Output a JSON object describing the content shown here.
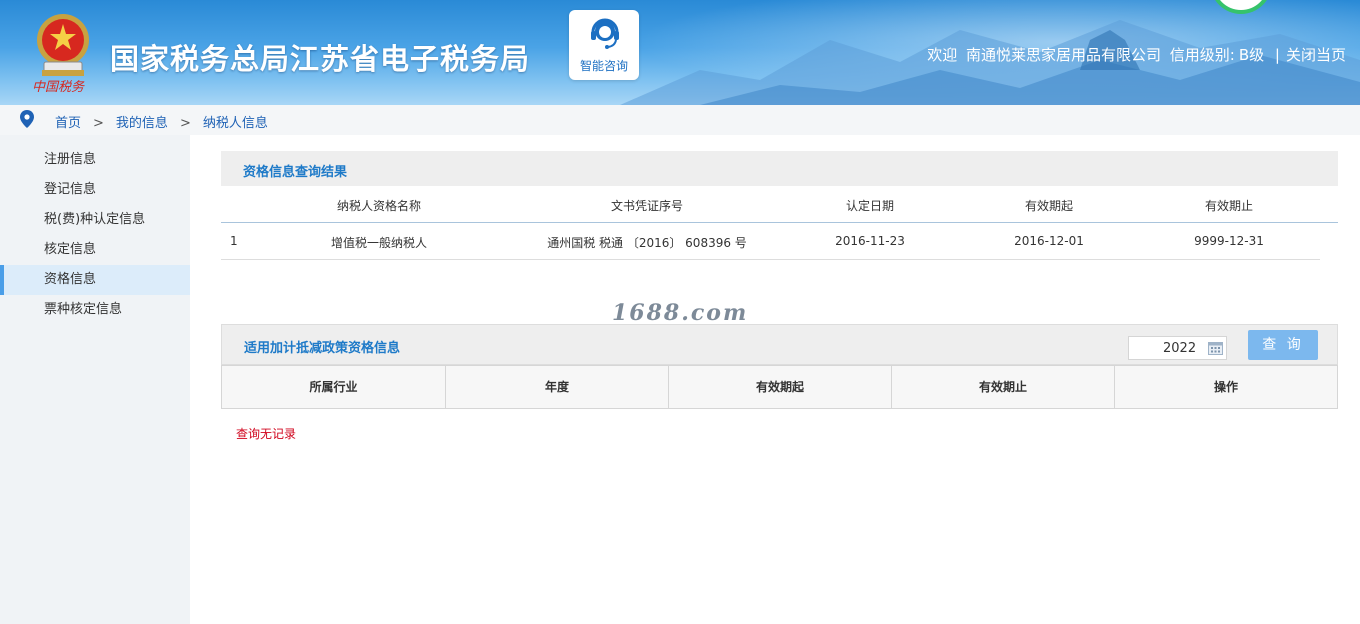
{
  "header": {
    "title": "国家税务总局江苏省电子税务局",
    "emblem_caption": "中国税务",
    "consult_label": "智能咨询",
    "welcome_prefix": "欢迎",
    "company": "南通悦莱思家居用品有限公司",
    "credit_label": "信用级别:",
    "credit_level": "B级",
    "separator": "|",
    "close_link": "关闭当页"
  },
  "breadcrumb": {
    "arrow": ">",
    "items": [
      "首页",
      "我的信息",
      "纳税人信息"
    ]
  },
  "sidebar": {
    "items": [
      {
        "label": "注册信息"
      },
      {
        "label": "登记信息"
      },
      {
        "label": "税(费)种认定信息"
      },
      {
        "label": "核定信息"
      },
      {
        "label": "资格信息"
      },
      {
        "label": "票种核定信息"
      }
    ],
    "active_index": 4
  },
  "qualification": {
    "title": "资格信息查询结果",
    "headers": [
      "纳税人资格名称",
      "文书凭证序号",
      "认定日期",
      "有效期起",
      "有效期止"
    ],
    "rows": [
      {
        "index": "1",
        "name": "增值税一般纳税人",
        "doc_no": "通州国税 税通 〔2016〕 608396 号",
        "date": "2016-11-23",
        "start": "2016-12-01",
        "end": "9999-12-31"
      }
    ]
  },
  "watermark": "1688.com",
  "policy": {
    "title": "适用加计抵减政策资格信息",
    "year_value": "2022",
    "query_label": "查 询",
    "headers": [
      "所属行业",
      "年度",
      "有效期起",
      "有效期止",
      "操作"
    ],
    "empty_text": "查询无记录"
  },
  "colors": {
    "accent": "#1e7ac8",
    "button": "#7cb8ee",
    "empty_text": "#d0021b",
    "active_sidebar": "#dcecfa"
  }
}
